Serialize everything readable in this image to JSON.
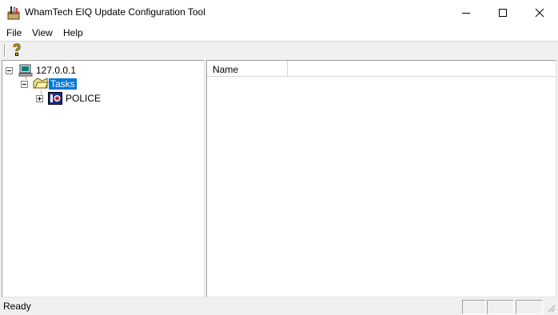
{
  "window": {
    "title": "WhamTech EIQ Update Configuration Tool",
    "app_icon": "tools-box-icon"
  },
  "menu": {
    "items": [
      {
        "label": "File"
      },
      {
        "label": "View"
      },
      {
        "label": "Help"
      }
    ]
  },
  "toolbar": {
    "buttons": [
      {
        "icon": "help-question-icon"
      }
    ]
  },
  "tree": {
    "nodes": [
      {
        "label": "127.0.0.1",
        "icon": "computer-icon",
        "expanded": true
      },
      {
        "label": "Tasks",
        "icon": "folder-open-icon",
        "expanded": true,
        "selected": true
      },
      {
        "label": "POLICE",
        "icon": "eiq-task-icon",
        "expanded": false
      }
    ]
  },
  "list": {
    "columns": [
      {
        "label": "Name"
      },
      {
        "label": ""
      }
    ]
  },
  "status": {
    "text": "Ready",
    "panels": [
      "",
      "",
      ""
    ]
  },
  "colors": {
    "selection": "#0078d7",
    "background": "#f0f0f0",
    "pane": "#ffffff"
  }
}
